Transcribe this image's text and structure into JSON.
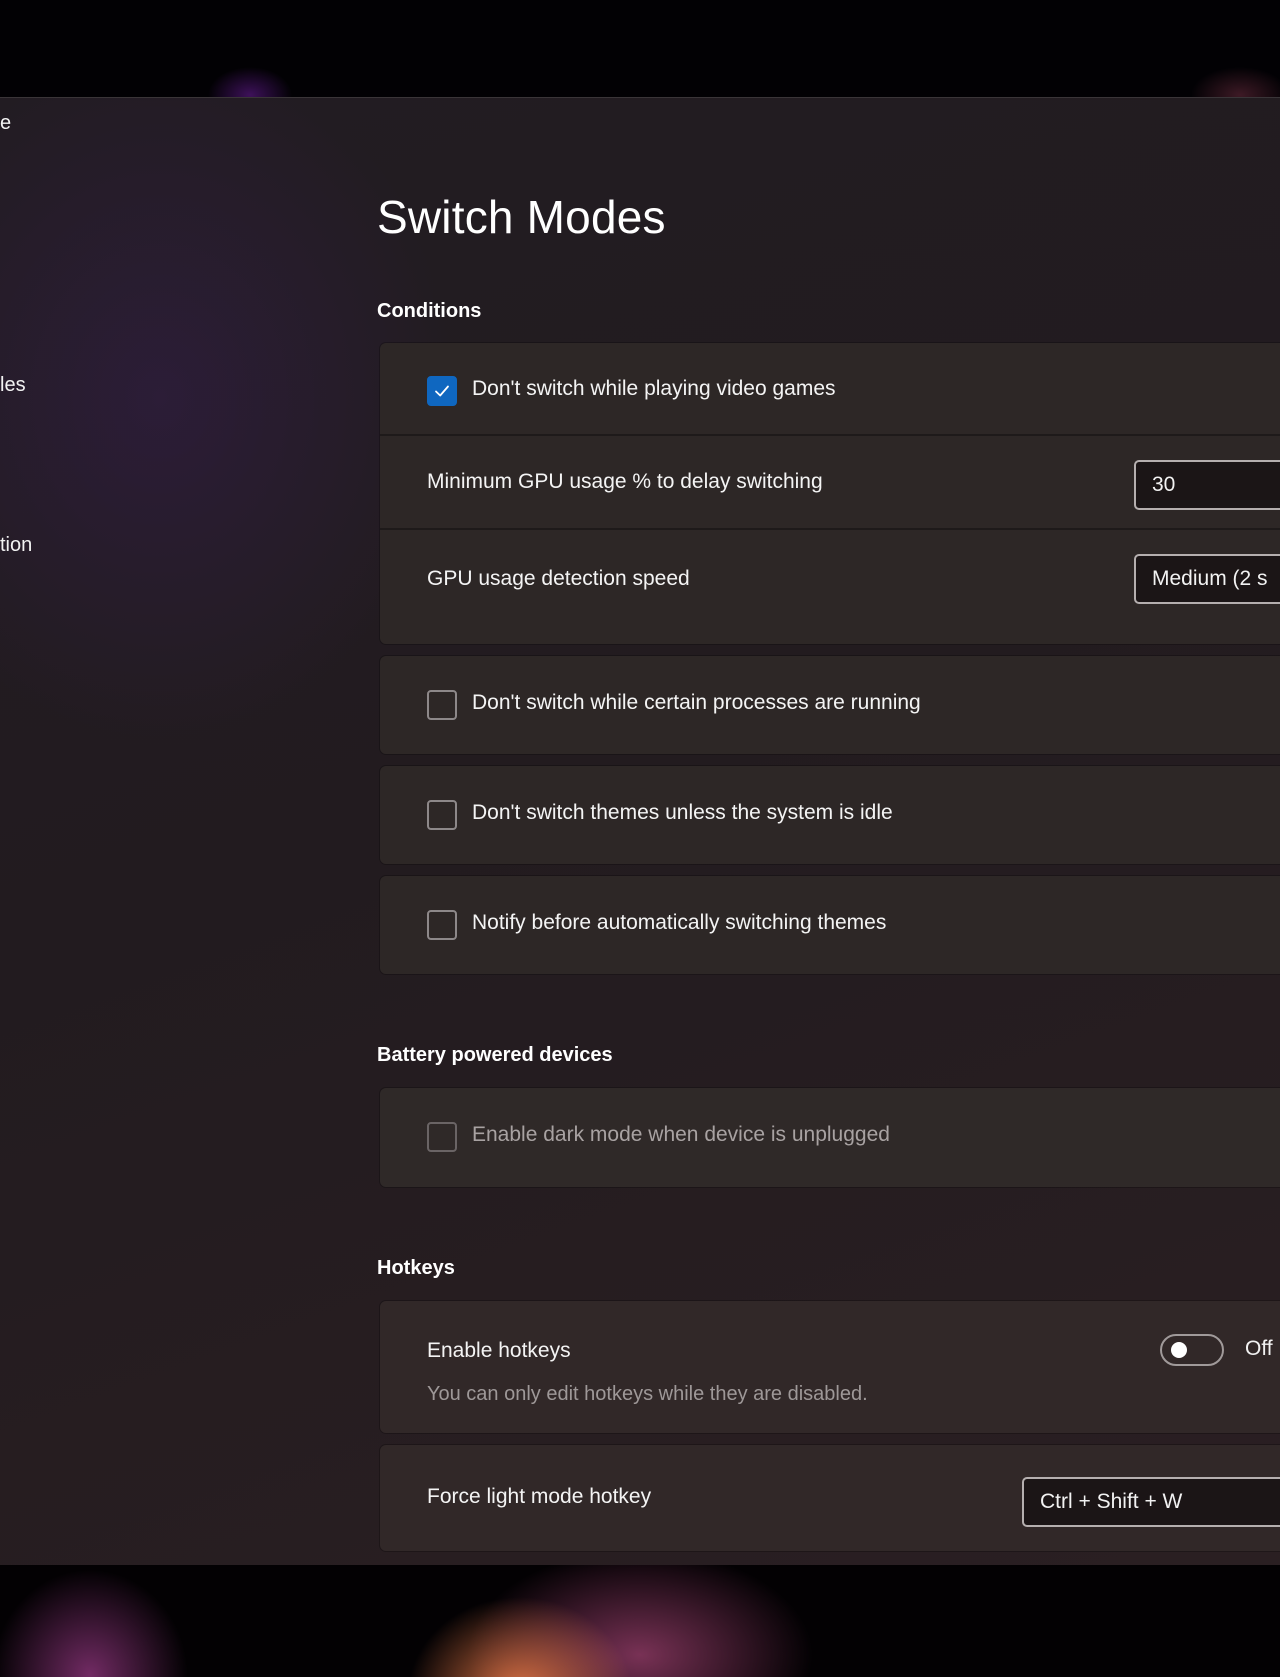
{
  "sidebar": {
    "items": [
      {
        "label": "e"
      },
      {
        "label": "les"
      },
      {
        "label": "tion"
      }
    ]
  },
  "page": {
    "title": "Switch Modes"
  },
  "conditions": {
    "heading": "Conditions",
    "games": {
      "label": "Don't switch while playing video games",
      "checked": true,
      "min_gpu_label": "Minimum GPU usage % to delay switching",
      "min_gpu_value": "30",
      "detection_label": "GPU usage detection speed",
      "detection_value": "Medium (2 s"
    },
    "processes": {
      "label": "Don't switch while certain processes are running",
      "checked": false
    },
    "idle": {
      "label": "Don't switch themes unless the system is idle",
      "checked": false
    },
    "notify": {
      "label": "Notify before automatically switching themes",
      "checked": false
    }
  },
  "battery": {
    "heading": "Battery powered devices",
    "unplugged": {
      "label": "Enable dark mode when device is unplugged",
      "checked": false,
      "disabled": true
    }
  },
  "hotkeys": {
    "heading": "Hotkeys",
    "enable_label": "Enable hotkeys",
    "enable_description": "You can only edit hotkeys while they are disabled.",
    "enable_state": "Off",
    "enabled": false,
    "force_light_label": "Force light mode hotkey",
    "force_light_value": "Ctrl + Shift + W"
  },
  "colors": {
    "accent": "#0f67c0",
    "card": "#2d2726",
    "window": "#221c22"
  }
}
